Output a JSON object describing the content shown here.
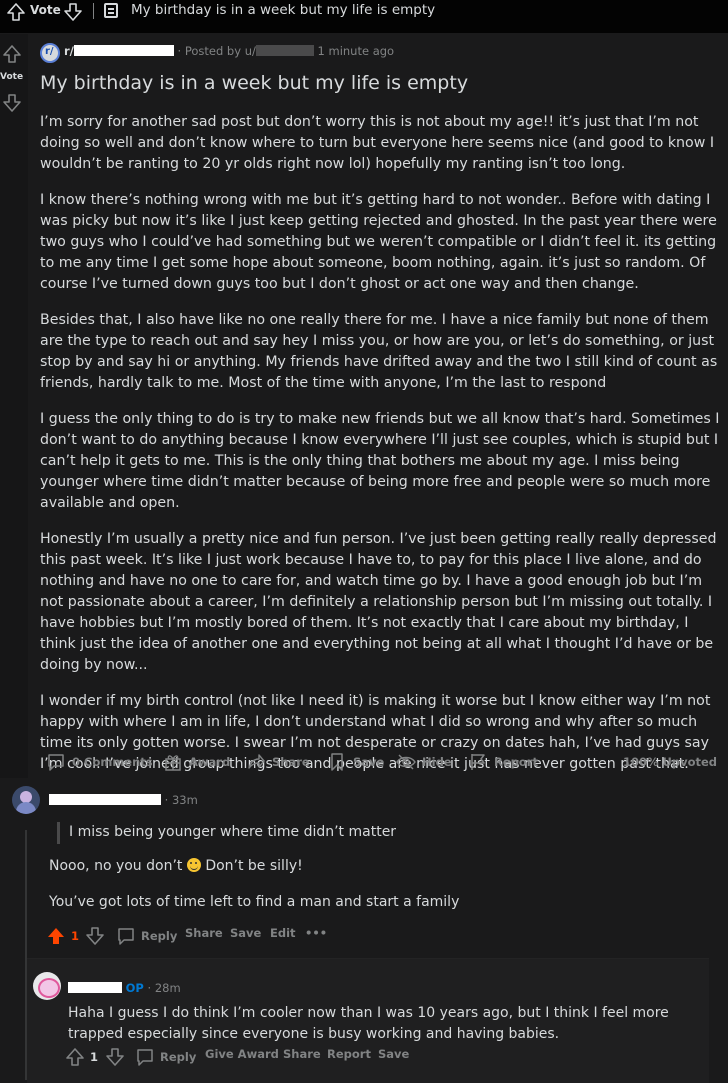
{
  "topbar": {
    "vote_label": "Vote",
    "title": "My birthday is in a week but my life is empty"
  },
  "rail": {
    "vote_label": "Vote"
  },
  "post": {
    "subreddit_prefix": "r/",
    "posted_by_prefix": "· Posted by u/",
    "time": "1 minute ago",
    "title": "My birthday is in a week but my life is empty",
    "paragraphs": [
      "I’m sorry for another sad post but don’t worry this is not about my age!! it’s just that I’m not doing so well and don’t know where to turn but everyone here seems nice (and good to know I wouldn’t be ranting to 20 yr olds right now lol) hopefully my ranting isn’t too long.",
      "I know there’s nothing wrong with me but it’s getting hard to not wonder.. Before with dating I was picky but now it’s like I just keep getting rejected and ghosted. In the past year there were two guys who I could’ve had something but we weren’t compatible or I didn’t feel it. its getting to me any time I get some hope about someone, boom nothing, again. it’s just so random. Of course I’ve turned down guys too but I don’t ghost or act one way and then change.",
      "Besides that, I also have like no one really there for me. I have a nice family but none of them are the type to reach out and say hey I miss you, or how are you, or let’s do something, or just stop by and say hi or anything. My friends have drifted away and the two I still kind of count as friends, hardly talk to me. Most of the time with anyone, I’m the last to respond",
      "I guess the only thing to do is try to make new friends but we all know that’s hard. Sometimes I don’t want to do anything because I know everywhere I’ll just see couples, which is stupid but I can’t help it gets to me. This is the only thing that bothers me about my age. I miss being younger where time didn’t matter because of being more free and people were so much more available and open.",
      "Honestly I’m usually a pretty nice and fun person. I’ve just been getting really really depressed this past week. It’s like I just work because I have to, to pay for this place I live alone, and do nothing and have no one to care for, and watch time go by. I have a good enough job but I’m not passionate about a career, I’m definitely a relationship person but I’m missing out totally. I have hobbies but I’m mostly bored of them. It’s not exactly that I care about my birthday, I think just the idea of another one and everything not being at all what I thought I’d have or be doing by now...",
      "I wonder if my birth control (not like I need it) is making it worse but I know either way I’m not happy with where I am in life, I don’t understand what I did so wrong and why after so much time its only gotten worse. I swear I’m not desperate or crazy on dates hah, I’ve had guys say I’m cool. I’ve joined group things too and people are nice it just has never gotten past that."
    ],
    "actions": {
      "comments": "0 Comments",
      "award": "Award",
      "share": "Share",
      "save": "Save",
      "hide": "Hide",
      "report": "Report"
    },
    "upvoted": "100% Upvoted"
  },
  "comment1": {
    "time": "· 33m",
    "quote": "I miss being younger where time didn’t matter",
    "line1_a": "Nooo, no you don’t",
    "line1_b": "Don’t be silly!",
    "line2": "You’ve got lots of time left to find a man and start a family",
    "score": "1",
    "actions": {
      "reply": "Reply",
      "share": "Share",
      "save": "Save",
      "edit": "Edit",
      "more": "•••"
    }
  },
  "comment2": {
    "op_label": "OP",
    "time": "· 28m",
    "text": "Haha I guess I do think I’m cooler now than I was 10 years ago, but I think I feel more trapped especially since everyone is busy working and having babies.",
    "score": "1",
    "actions": {
      "reply": "Reply",
      "give_award": "Give Award",
      "share": "Share",
      "report": "Report",
      "save": "Save"
    }
  },
  "colors": {
    "background": "#1a1a1b",
    "text": "#d7dadc",
    "muted": "#818384",
    "upvote_active": "#ff4500",
    "op": "#0079d3"
  }
}
